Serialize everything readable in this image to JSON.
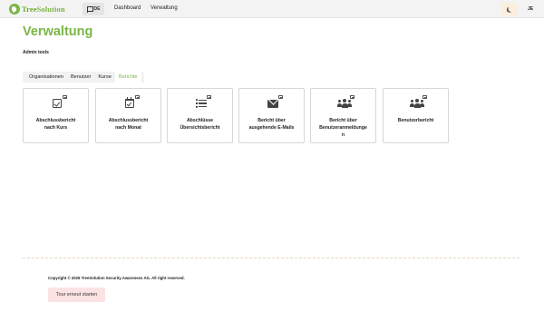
{
  "header": {
    "logo": {
      "part1": "Tree",
      "part2": "Solution"
    },
    "language_label": "DE",
    "nav": [
      {
        "label": "Dashboard"
      },
      {
        "label": "Verwaltung"
      }
    ],
    "user_initials": "JE"
  },
  "page": {
    "title": "Verwaltung",
    "subtitle": "Admin tools"
  },
  "tabs": [
    {
      "label": "Organisationen",
      "active": false
    },
    {
      "label": "Benutzer",
      "active": false
    },
    {
      "label": "Kurse",
      "active": false
    },
    {
      "label": "Berichte",
      "active": true
    }
  ],
  "reports": [
    {
      "icon": "check-square-icon",
      "line1": "Abschlussbericht",
      "line2": "nach Kurs",
      "line3": ""
    },
    {
      "icon": "calendar-check-icon",
      "line1": "Abschlussbericht",
      "line2": "nach Monat",
      "line3": ""
    },
    {
      "icon": "list-icon",
      "line1": "Abschlüsse",
      "line2": "Übersichtsbericht",
      "line3": ""
    },
    {
      "icon": "envelope-icon",
      "line1": "Bericht über",
      "line2": "ausgehende E-Mails",
      "line3": ""
    },
    {
      "icon": "users-icon",
      "line1": "Bericht über",
      "line2": "Benutzeranmeldunge",
      "line3": "n"
    },
    {
      "icon": "users-icon",
      "line1": "Benutzerbericht",
      "line2": "",
      "line3": ""
    }
  ],
  "footer": {
    "copyright": "Copyright © 2026 TreeSolution Security Awareness AG. All right reserved.",
    "tour_button": "Tour erneut starten"
  },
  "colors": {
    "brand_green": "#7ab648",
    "tour_button_bg": "#fbe3e3",
    "theme_button_bg": "#fbeede"
  }
}
